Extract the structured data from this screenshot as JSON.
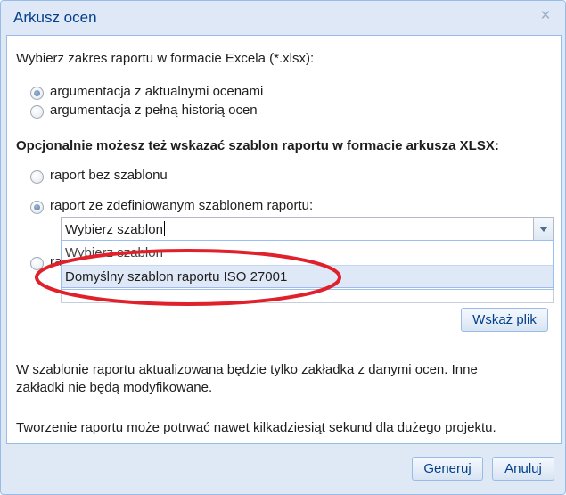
{
  "window": {
    "title": "Arkusz ocen"
  },
  "range": {
    "prompt": "Wybierz zakres raportu w formacie Excela (*.xlsx):",
    "options": [
      {
        "label": "argumentacja z aktualnymi ocenami",
        "checked": true
      },
      {
        "label": "argumentacja z pełną historią ocen",
        "checked": false
      }
    ]
  },
  "template": {
    "prompt": "Opcjonalnie możesz też wskazać szablon raportu w formacie arkusza XLSX:",
    "options": [
      {
        "label": "raport bez szablonu",
        "checked": false
      },
      {
        "label": "raport ze zdefiniowanym szablonem raportu:",
        "checked": true
      },
      {
        "label": "ra",
        "checked": false
      }
    ],
    "combo": {
      "value": "Wybierz szablon",
      "list": [
        "Wybierz szablon",
        "Domyślny szablon raportu ISO 27001"
      ],
      "selected_index": 1
    },
    "browse_label": "Wskaż plik"
  },
  "info": {
    "note1": "W szablonie raportu aktualizowana będzie tylko zakładka z danymi ocen. Inne",
    "note1b": "zakładki nie będą modyfikowane.",
    "note2": "Tworzenie raportu może potrwać nawet kilkadziesiąt sekund dla dużego projektu."
  },
  "footer": {
    "generate_label": "Generuj",
    "cancel_label": "Anuluj"
  },
  "colors": {
    "title": "#04408c",
    "border": "#99bbe8",
    "annotation": "#e0202a"
  }
}
